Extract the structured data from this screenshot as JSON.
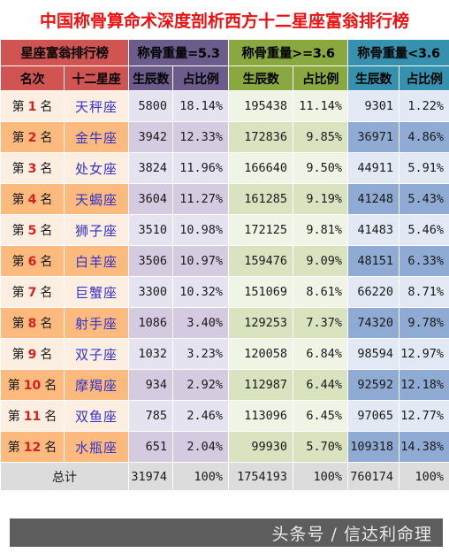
{
  "page_title": "中国称骨算命术深度剖析西方十二星座富翁排行榜",
  "title_color": "#ee1111",
  "table": {
    "group_headers": [
      {
        "label": "星座富翁排行榜",
        "color": "#cf5452",
        "span": 2
      },
      {
        "label": "称骨重量=5.3",
        "color": "#6b5c8c",
        "span": 2
      },
      {
        "label": "称骨重量>=3.6",
        "color": "#89a840",
        "span": 2
      },
      {
        "label": "称骨重量<3.6",
        "color": "#3591ad",
        "span": 2
      }
    ],
    "column_headers": [
      {
        "label": "名次",
        "color": "#cf5452"
      },
      {
        "label": "十二星座",
        "color": "#cf5452"
      },
      {
        "label": "生辰数",
        "color": "#6b5c8c"
      },
      {
        "label": "占比例",
        "color": "#6b5c8c"
      },
      {
        "label": "生辰数",
        "color": "#89a840"
      },
      {
        "label": "占比例",
        "color": "#89a840"
      },
      {
        "label": "生辰数",
        "color": "#3591ad"
      },
      {
        "label": "占比例",
        "color": "#3591ad"
      }
    ],
    "rank_prefix": "第",
    "rank_suffix": "名",
    "rows": [
      {
        "rank": "1",
        "sign": "天秤座",
        "c1": "5800",
        "p1": "18.14%",
        "c2": "195438",
        "p2": "11.14%",
        "c3": "9301",
        "p3": "1.22%"
      },
      {
        "rank": "2",
        "sign": "金牛座",
        "c1": "3942",
        "p1": "12.33%",
        "c2": "172836",
        "p2": "9.85%",
        "c3": "36971",
        "p3": "4.86%"
      },
      {
        "rank": "3",
        "sign": "处女座",
        "c1": "3824",
        "p1": "11.96%",
        "c2": "166640",
        "p2": "9.50%",
        "c3": "44911",
        "p3": "5.91%"
      },
      {
        "rank": "4",
        "sign": "天蝎座",
        "c1": "3604",
        "p1": "11.27%",
        "c2": "161285",
        "p2": "9.19%",
        "c3": "41248",
        "p3": "5.43%"
      },
      {
        "rank": "5",
        "sign": "狮子座",
        "c1": "3510",
        "p1": "10.98%",
        "c2": "172125",
        "p2": "9.81%",
        "c3": "41483",
        "p3": "5.46%"
      },
      {
        "rank": "6",
        "sign": "白羊座",
        "c1": "3506",
        "p1": "10.97%",
        "c2": "159476",
        "p2": "9.09%",
        "c3": "48151",
        "p3": "6.33%"
      },
      {
        "rank": "7",
        "sign": "巨蟹座",
        "c1": "3300",
        "p1": "10.32%",
        "c2": "151069",
        "p2": "8.61%",
        "c3": "66220",
        "p3": "8.71%"
      },
      {
        "rank": "8",
        "sign": "射手座",
        "c1": "1086",
        "p1": "3.40%",
        "c2": "129253",
        "p2": "7.37%",
        "c3": "74320",
        "p3": "9.78%"
      },
      {
        "rank": "9",
        "sign": "双子座",
        "c1": "1032",
        "p1": "3.23%",
        "c2": "120058",
        "p2": "6.84%",
        "c3": "98594",
        "p3": "12.97%"
      },
      {
        "rank": "10",
        "sign": "摩羯座",
        "c1": "934",
        "p1": "2.92%",
        "c2": "112987",
        "p2": "6.44%",
        "c3": "92592",
        "p3": "12.18%"
      },
      {
        "rank": "11",
        "sign": "双鱼座",
        "c1": "785",
        "p1": "2.46%",
        "c2": "113096",
        "p2": "6.45%",
        "c3": "97065",
        "p3": "12.77%"
      },
      {
        "rank": "12",
        "sign": "水瓶座",
        "c1": "651",
        "p1": "2.04%",
        "c2": "99930",
        "p2": "5.70%",
        "c3": "109318",
        "p3": "14.38%"
      }
    ],
    "total_row": {
      "label": "总计",
      "c1": "31974",
      "p1": "100%",
      "c2": "1754193",
      "p2": "100%",
      "c3": "760174",
      "p3": "100%"
    }
  },
  "footer": {
    "text": "头条号 / 信达利命理"
  },
  "chart_data": {
    "type": "table",
    "title": "中国称骨算命术深度剖析西方十二星座富翁排行榜",
    "categories": [
      "天秤座",
      "金牛座",
      "处女座",
      "天蝎座",
      "狮子座",
      "白羊座",
      "巨蟹座",
      "射手座",
      "双子座",
      "摩羯座",
      "双鱼座",
      "水瓶座"
    ],
    "series": [
      {
        "name": "称骨重量=5.3 生辰数",
        "values": [
          5800,
          3942,
          3824,
          3604,
          3510,
          3506,
          3300,
          1086,
          1032,
          934,
          785,
          651
        ]
      },
      {
        "name": "称骨重量=5.3 占比例",
        "values": [
          18.14,
          12.33,
          11.96,
          11.27,
          10.98,
          10.97,
          10.32,
          3.4,
          3.23,
          2.92,
          2.46,
          2.04
        ]
      },
      {
        "name": "称骨重量>=3.6 生辰数",
        "values": [
          195438,
          172836,
          166640,
          161285,
          172125,
          159476,
          151069,
          129253,
          120058,
          112987,
          113096,
          99930
        ]
      },
      {
        "name": "称骨重量>=3.6 占比例",
        "values": [
          11.14,
          9.85,
          9.5,
          9.19,
          9.81,
          9.09,
          8.61,
          7.37,
          6.84,
          6.44,
          6.45,
          5.7
        ]
      },
      {
        "name": "称骨重量<3.6 生辰数",
        "values": [
          9301,
          36971,
          44911,
          41248,
          41483,
          48151,
          66220,
          74320,
          98594,
          92592,
          97065,
          109318
        ]
      },
      {
        "name": "称骨重量<3.6 占比例",
        "values": [
          1.22,
          4.86,
          5.91,
          5.43,
          5.46,
          6.33,
          8.71,
          9.78,
          12.97,
          12.18,
          12.77,
          14.38
        ]
      }
    ],
    "totals": {
      "c1": 31974,
      "c2": 1754193,
      "c3": 760174
    },
    "xlabel": "十二星座",
    "ylabel": "生辰数 / 占比例"
  }
}
